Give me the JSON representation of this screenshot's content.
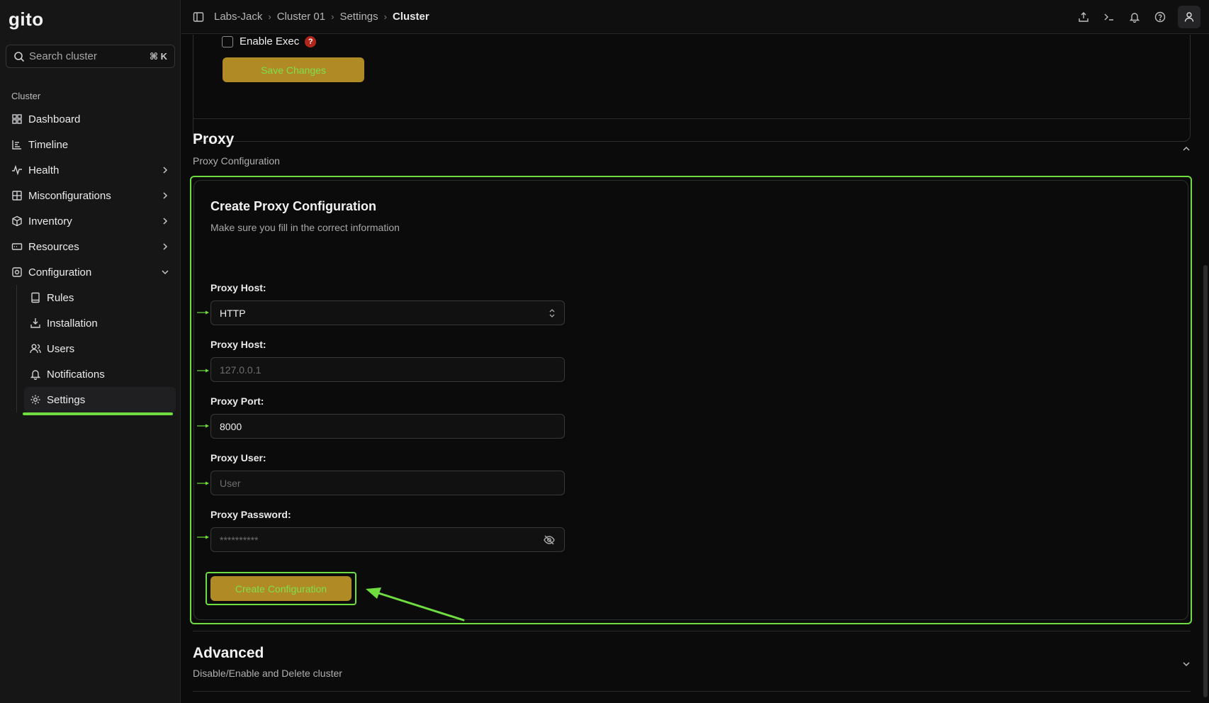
{
  "app": {
    "logo_text": "gito"
  },
  "search": {
    "placeholder": "Search cluster",
    "shortcut": "⌘ K"
  },
  "sidebar": {
    "section_label": "Cluster",
    "items": [
      {
        "label": "Dashboard",
        "icon": "grid-icon"
      },
      {
        "label": "Timeline",
        "icon": "timeline-icon"
      },
      {
        "label": "Health",
        "icon": "pulse-icon",
        "has_children": true
      },
      {
        "label": "Misconfigurations",
        "icon": "misconfig-icon",
        "has_children": true
      },
      {
        "label": "Inventory",
        "icon": "box-icon",
        "has_children": true
      },
      {
        "label": "Resources",
        "icon": "resources-icon",
        "has_children": true
      },
      {
        "label": "Configuration",
        "icon": "configuration-icon",
        "expanded": true
      }
    ],
    "sub_items": [
      {
        "label": "Rules",
        "icon": "book-icon"
      },
      {
        "label": "Installation",
        "icon": "install-icon"
      },
      {
        "label": "Users",
        "icon": "users-icon"
      },
      {
        "label": "Notifications",
        "icon": "bell-icon"
      },
      {
        "label": "Settings",
        "icon": "gear-icon",
        "active": true
      }
    ]
  },
  "breadcrumb": [
    "Labs-Jack",
    "Cluster 01",
    "Settings",
    "Cluster"
  ],
  "exec": {
    "label": "Enable Exec",
    "help": "?",
    "checked": false
  },
  "save_button": "Save Changes",
  "proxy": {
    "title": "Proxy",
    "subtitle": "Proxy Configuration",
    "form_title": "Create Proxy Configuration",
    "form_subtitle": "Make sure you fill in the correct information",
    "fields": {
      "type": {
        "label": "Proxy Host:",
        "value": "HTTP"
      },
      "host": {
        "label": "Proxy Host:",
        "placeholder": "127.0.0.1"
      },
      "port": {
        "label": "Proxy Port:",
        "value": "8000"
      },
      "user": {
        "label": "Proxy User:",
        "placeholder": "User"
      },
      "password": {
        "label": "Proxy Password:",
        "placeholder": "**********"
      }
    },
    "create_button": "Create Configuration"
  },
  "advanced": {
    "title": "Advanced",
    "subtitle": "Disable/Enable and Delete cluster"
  },
  "colors": {
    "accent": "#6fdc3f",
    "button_bg": "#b08a24",
    "button_text": "#7ee04c",
    "help_badge": "#b0261d"
  }
}
